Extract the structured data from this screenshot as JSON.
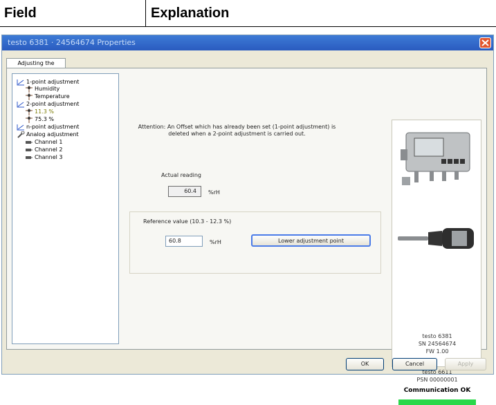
{
  "doc_header": {
    "col1": "Field",
    "col2": "Explanation"
  },
  "window": {
    "title": "testo 6381 · 24564674 Properties"
  },
  "tab": {
    "label": "Adjusting the transmitter"
  },
  "tree": [
    {
      "label": "1-point adjustment",
      "icon": "chart-icon"
    },
    {
      "label": "Humidity",
      "icon": "sensor-icon"
    },
    {
      "label": "Temperature",
      "icon": "sensor-icon"
    },
    {
      "label": "2-point adjustment",
      "icon": "chart-icon"
    },
    {
      "label": "11.3 %",
      "icon": "sensor-icon"
    },
    {
      "label": "75.3 %",
      "icon": "sensor-icon"
    },
    {
      "label": "n-point adjustment",
      "icon": "chart-icon"
    },
    {
      "label": "Analog adjustment",
      "icon": "wrench-icon"
    },
    {
      "label": "Channel 1",
      "icon": "channel-icon"
    },
    {
      "label": "Channel 2",
      "icon": "channel-icon"
    },
    {
      "label": "Channel 3",
      "icon": "channel-icon"
    }
  ],
  "main": {
    "attention": "Attention: An Offset which has already been set (1-point adjustment) is deleted when a 2-point adjustment is carried out.",
    "actual_label": "Actual reading",
    "actual_value": "60.4",
    "actual_unit": "%rH",
    "ref_label": "Reference value (10.3 - 12.3 %)",
    "ref_value": "60.8",
    "ref_unit": "%rH",
    "lower_button": "Lower adjustment point"
  },
  "device": {
    "transmitter": "testo 6381",
    "sn": "SN 24564674",
    "fw": "FW 1.00",
    "probe": "testo 6611",
    "psn": "PSN 00000001",
    "comm_status": "Communication OK",
    "comm_color": "#2ad84a"
  },
  "footer": {
    "ok": "OK",
    "cancel": "Cancel",
    "apply": "Apply"
  }
}
